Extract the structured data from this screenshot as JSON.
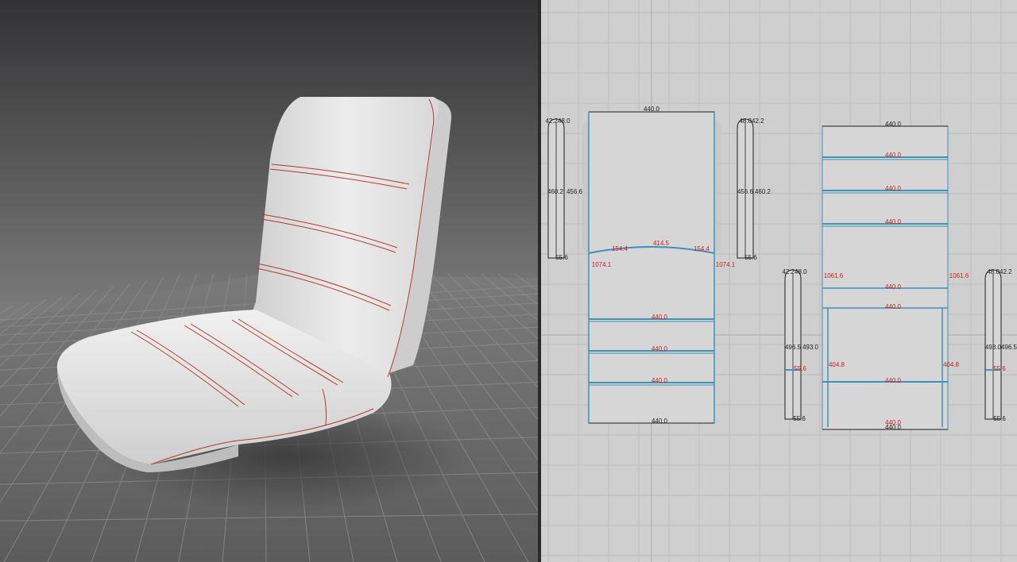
{
  "viewport_3d": {
    "object": "chair-seat",
    "colors": {
      "sky_top": "#3b3b3d",
      "sky_bottom": "#9a9a9a",
      "ground": "#6d6d6d",
      "grid": "#8a8a8a",
      "fabric": "#e4e4e4",
      "stitch": "#c0392b"
    }
  },
  "viewport_2d": {
    "colors": {
      "background": "#cfcfcf",
      "grid": "#bdbdbd",
      "panel": "#d6d6d6",
      "outline": "#1e1e1e",
      "seam": "#3b93b5",
      "red_label": "#cc1f1f"
    },
    "panels": {
      "back_panel": {
        "top_width": "440.0",
        "bottom_width": "440.0",
        "curve_left": "154.4",
        "curve_mid": "414.5",
        "curve_right": "154.4",
        "left_mark": "1074.1",
        "right_mark": "1074.1",
        "strip_labels": [
          "440.0",
          "440.0",
          "440.0"
        ]
      },
      "left_strip_top": {
        "top_a": "42.2",
        "top_b": "48.0",
        "height_a": "460.2",
        "height_b": "456.6",
        "bottom": "55.6"
      },
      "right_strip_top": {
        "top_a": "48.0",
        "top_b": "42.2",
        "height_a": "456.6",
        "height_b": "460.2",
        "bottom": "55.6"
      },
      "left_strip_bottom": {
        "top_a": "42.2",
        "top_b": "48.0",
        "height_a": "496.5",
        "height_b": "493.0",
        "mid": "55.6",
        "bottom": "55.6"
      },
      "right_strip_bottom": {
        "top_a": "48.0",
        "top_b": "42.2",
        "height_a": "493.0",
        "height_b": "496.5",
        "mid": "55.6",
        "bottom": "55.6"
      },
      "seat_panel": {
        "top_width": "440.0",
        "strip_labels": [
          "440.0",
          "440.0",
          "440.0"
        ],
        "mid_label": "440.0",
        "lower_top_label": "440.0",
        "center_label": "440.0",
        "bottom_red_label": "440.0",
        "bottom_width": "440.0",
        "left_mark": "1061.6",
        "right_mark": "1061.6",
        "left_side": "404.8",
        "right_side": "404.8"
      }
    }
  }
}
